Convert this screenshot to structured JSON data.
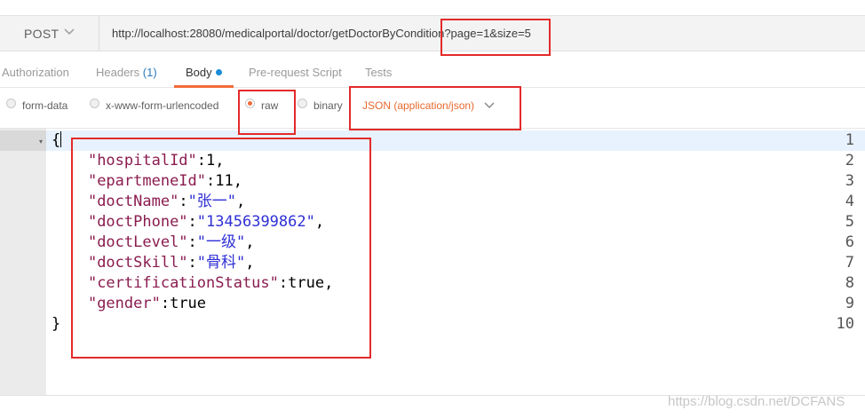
{
  "request": {
    "method": "POST",
    "url": "http://localhost:28080/medicalportal/doctor/getDoctorByCondition?page=1&size=5"
  },
  "tabs": [
    {
      "label": "Authorization"
    },
    {
      "label": "Headers",
      "count": "(1)"
    },
    {
      "label": "Body"
    },
    {
      "label": "Pre-request Script"
    },
    {
      "label": "Tests"
    }
  ],
  "body_modes": {
    "form_data": "form-data",
    "urlencoded": "x-www-form-urlencoded",
    "raw": "raw",
    "binary": "binary",
    "content_type": "JSON (application/json)"
  },
  "editor": {
    "line_numbers": [
      "1",
      "2",
      "3",
      "4",
      "5",
      "6",
      "7",
      "8",
      "9",
      "10"
    ],
    "lines": [
      {
        "parts": [
          {
            "t": "p",
            "v": "{"
          }
        ]
      },
      {
        "parts": [
          {
            "t": "p",
            "v": "    "
          },
          {
            "t": "k",
            "v": "\"hospitalId\""
          },
          {
            "t": "p",
            "v": ":1,"
          }
        ]
      },
      {
        "parts": [
          {
            "t": "p",
            "v": "    "
          },
          {
            "t": "k",
            "v": "\"epartmeneId\""
          },
          {
            "t": "p",
            "v": ":11,"
          }
        ]
      },
      {
        "parts": [
          {
            "t": "p",
            "v": "    "
          },
          {
            "t": "k",
            "v": "\"doctName\""
          },
          {
            "t": "p",
            "v": ":"
          },
          {
            "t": "s",
            "v": "\"张一\""
          },
          {
            "t": "p",
            "v": ","
          }
        ]
      },
      {
        "parts": [
          {
            "t": "p",
            "v": "    "
          },
          {
            "t": "k",
            "v": "\"doctPhone\""
          },
          {
            "t": "p",
            "v": ":"
          },
          {
            "t": "s",
            "v": "\"13456399862\""
          },
          {
            "t": "p",
            "v": ","
          }
        ]
      },
      {
        "parts": [
          {
            "t": "p",
            "v": "    "
          },
          {
            "t": "k",
            "v": "\"doctLevel\""
          },
          {
            "t": "p",
            "v": ":"
          },
          {
            "t": "s",
            "v": "\"一级\""
          },
          {
            "t": "p",
            "v": ","
          }
        ]
      },
      {
        "parts": [
          {
            "t": "p",
            "v": "    "
          },
          {
            "t": "k",
            "v": "\"doctSkill\""
          },
          {
            "t": "p",
            "v": ":"
          },
          {
            "t": "s",
            "v": "\"骨科\""
          },
          {
            "t": "p",
            "v": ","
          }
        ]
      },
      {
        "parts": [
          {
            "t": "p",
            "v": "    "
          },
          {
            "t": "k",
            "v": "\"certificationStatus\""
          },
          {
            "t": "p",
            "v": ":true,"
          }
        ]
      },
      {
        "parts": [
          {
            "t": "p",
            "v": "    "
          },
          {
            "t": "k",
            "v": "\"gender\""
          },
          {
            "t": "p",
            "v": ":true"
          }
        ]
      },
      {
        "parts": [
          {
            "t": "p",
            "v": "}"
          }
        ]
      }
    ]
  },
  "watermark": "https://blog.csdn.net/DCFANS",
  "colors": {
    "accent": "#f26b3a",
    "annotation": "#e42a2a",
    "json_key": "#8a1c4f",
    "json_string": "#2f2fd6"
  }
}
